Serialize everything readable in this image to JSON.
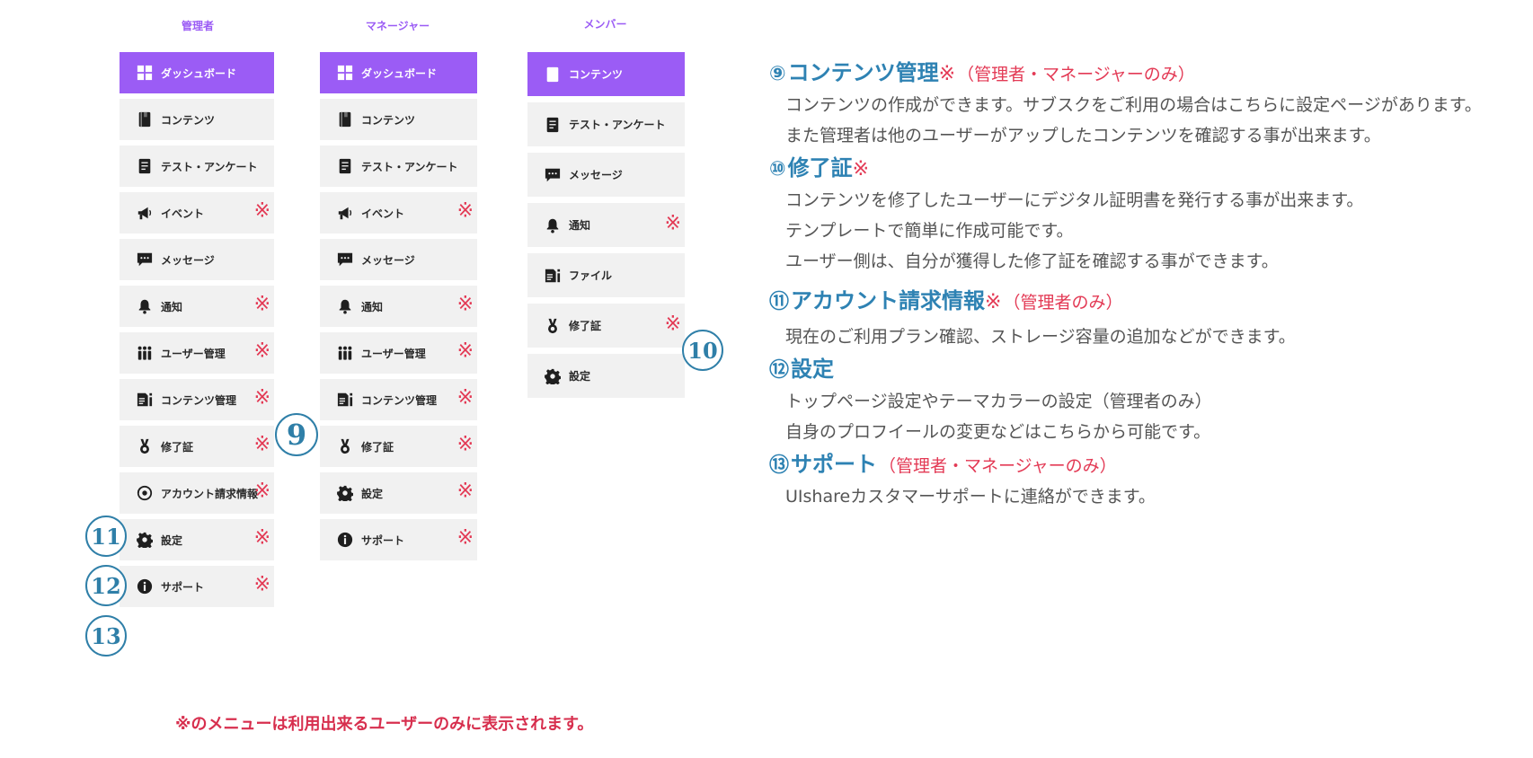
{
  "columns": [
    {
      "title": "管理者",
      "items": [
        {
          "label": "ダッシュボード",
          "icon": "dashboard-icon",
          "active": true,
          "mark": ""
        },
        {
          "label": "コンテンツ",
          "icon": "book-icon",
          "active": false,
          "mark": ""
        },
        {
          "label": "テスト・アンケート",
          "icon": "test-icon",
          "active": false,
          "mark": ""
        },
        {
          "label": "イベント",
          "icon": "megaphone-icon",
          "active": false,
          "mark": "※"
        },
        {
          "label": "メッセージ",
          "icon": "message-icon",
          "active": false,
          "mark": ""
        },
        {
          "label": "通知",
          "icon": "bell-icon",
          "active": false,
          "mark": "※"
        },
        {
          "label": "ユーザー管理",
          "icon": "users-icon",
          "active": false,
          "mark": "※"
        },
        {
          "label": "コンテンツ管理",
          "icon": "content-manage-icon",
          "active": false,
          "mark": "※"
        },
        {
          "label": "修了証",
          "icon": "medal-icon",
          "active": false,
          "mark": "※"
        },
        {
          "label": "アカウント請求情報",
          "icon": "billing-icon",
          "active": false,
          "mark": "※"
        },
        {
          "label": "設定",
          "icon": "gear-icon",
          "active": false,
          "mark": "※"
        },
        {
          "label": "サポート",
          "icon": "info-icon",
          "active": false,
          "mark": "※"
        }
      ]
    },
    {
      "title": "マネージャー",
      "items": [
        {
          "label": "ダッシュボード",
          "icon": "dashboard-icon",
          "active": true,
          "mark": ""
        },
        {
          "label": "コンテンツ",
          "icon": "book-icon",
          "active": false,
          "mark": ""
        },
        {
          "label": "テスト・アンケート",
          "icon": "test-icon",
          "active": false,
          "mark": ""
        },
        {
          "label": "イベント",
          "icon": "megaphone-icon",
          "active": false,
          "mark": "※"
        },
        {
          "label": "メッセージ",
          "icon": "message-icon",
          "active": false,
          "mark": ""
        },
        {
          "label": "通知",
          "icon": "bell-icon",
          "active": false,
          "mark": "※"
        },
        {
          "label": "ユーザー管理",
          "icon": "users-icon",
          "active": false,
          "mark": "※"
        },
        {
          "label": "コンテンツ管理",
          "icon": "content-manage-icon",
          "active": false,
          "mark": "※"
        },
        {
          "label": "修了証",
          "icon": "medal-icon",
          "active": false,
          "mark": "※"
        },
        {
          "label": "設定",
          "icon": "gear-icon",
          "active": false,
          "mark": "※"
        },
        {
          "label": "サポート",
          "icon": "info-icon",
          "active": false,
          "mark": "※"
        }
      ]
    },
    {
      "title": "メンバー",
      "items": [
        {
          "label": "コンテンツ",
          "icon": "book-icon",
          "active": true,
          "mark": ""
        },
        {
          "label": "テスト・アンケート",
          "icon": "test-icon",
          "active": false,
          "mark": ""
        },
        {
          "label": "メッセージ",
          "icon": "message-icon",
          "active": false,
          "mark": ""
        },
        {
          "label": "通知",
          "icon": "bell-icon",
          "active": false,
          "mark": "※"
        },
        {
          "label": "ファイル",
          "icon": "content-manage-icon",
          "active": false,
          "mark": ""
        },
        {
          "label": "修了証",
          "icon": "medal-icon",
          "active": false,
          "mark": "※"
        },
        {
          "label": "設定",
          "icon": "gear-icon",
          "active": false,
          "mark": ""
        }
      ]
    }
  ],
  "callouts": {
    "c9": "9",
    "c10": "10",
    "c11": "11",
    "c12": "12",
    "c13": "13"
  },
  "footnote": "※のメニューは利用出来るユーザーのみに表示されます。",
  "sections": [
    {
      "num": "⑨",
      "title": "コンテンツ管理",
      "mark": "※",
      "note": "（管理者・マネージャーのみ）",
      "lines": [
        "コンテンツの作成ができます。サブスクをご利用の場合はこちらに設定ページがあります。",
        "また管理者は他のユーザーがアップしたコンテンツを確認する事が出来ます。"
      ]
    },
    {
      "num": "⑩",
      "title": "修了証",
      "mark": "※",
      "note": "",
      "lines": [
        "コンテンツを修了したユーザーにデジタル証明書を発行する事が出来ます。",
        "テンプレートで簡単に作成可能です。",
        "ユーザー側は、自分が獲得した修了証を確認する事ができます。"
      ]
    },
    {
      "num": "⑪",
      "title": "アカウント請求情報",
      "mark": "※",
      "note": "（管理者のみ）",
      "lines": [
        "現在のご利用プラン確認、ストレージ容量の追加などができます。"
      ]
    },
    {
      "num": "⑫",
      "title": "設定",
      "mark": "",
      "note": "",
      "lines": [
        "トップページ設定やテーマカラーの設定（管理者のみ）",
        "自身のプロフイールの変更などはこちらから可能です。"
      ]
    },
    {
      "num": "⑬",
      "title": "サポート",
      "mark": "",
      "note": "（管理者・マネージャーのみ）",
      "lines": [
        "UIshareカスタマーサポートに連絡ができます。"
      ]
    }
  ],
  "colors": {
    "accent": "#9b5cf5",
    "mark": "#e33a55",
    "heading": "#2e82b3"
  }
}
